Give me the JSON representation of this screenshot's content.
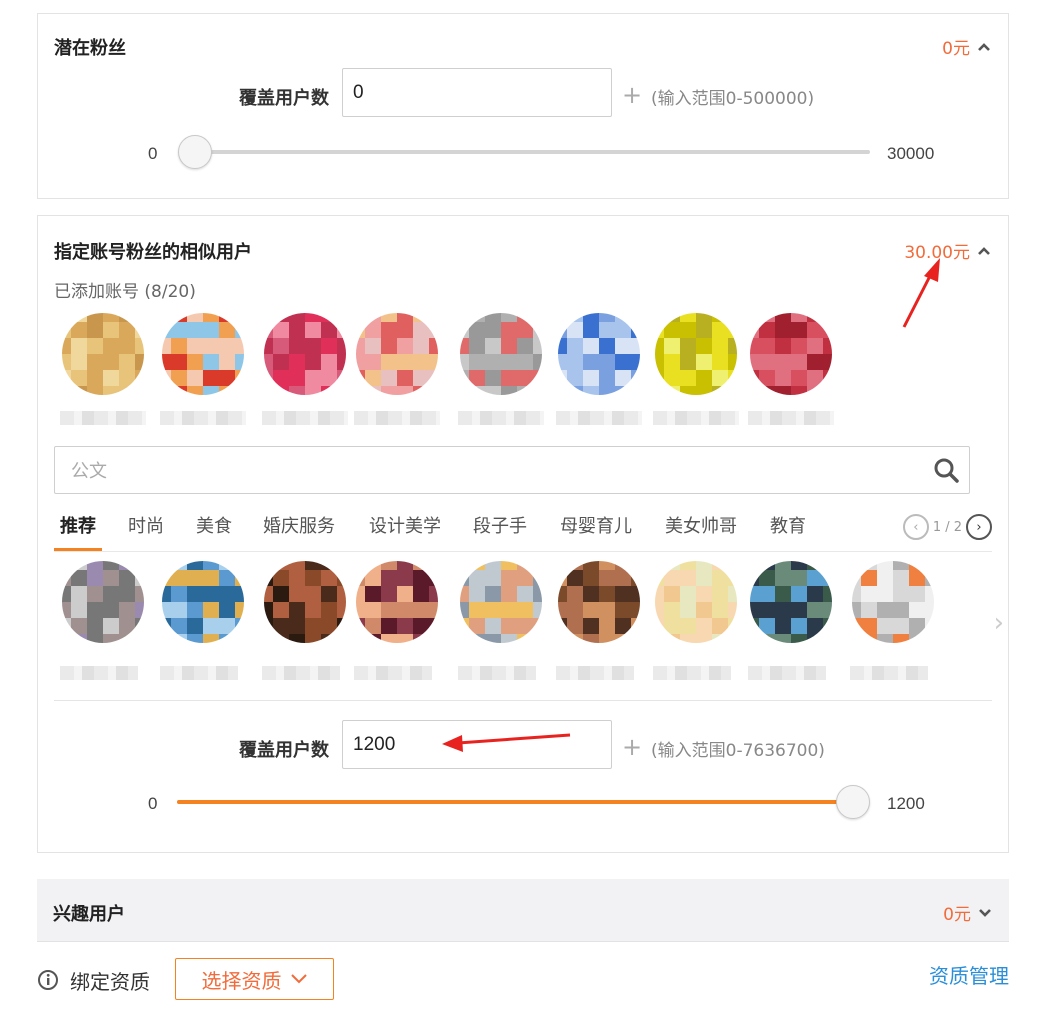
{
  "potential_fans": {
    "title": "潜在粉丝",
    "price": "0元",
    "cover_label": "覆盖用户数",
    "cover_value": "0",
    "plus": "+",
    "range_hint": "(输入范围0-500000)",
    "slider_min": "0",
    "slider_max": "30000",
    "slider_fraction": 0
  },
  "similar_users": {
    "title": "指定账号粉丝的相似用户",
    "price": "30.00元",
    "added_count": "已添加账号 (8/20)",
    "search_placeholder": "公文",
    "tabs": [
      {
        "label": "推荐",
        "active": true
      },
      {
        "label": "时尚"
      },
      {
        "label": "美食"
      },
      {
        "label": "婚庆服务"
      },
      {
        "label": "设计美学"
      },
      {
        "label": "段子手"
      },
      {
        "label": "母婴育儿"
      },
      {
        "label": "美女帅哥"
      },
      {
        "label": "教育"
      }
    ],
    "pager": "1 / 2",
    "cover_label": "覆盖用户数",
    "cover_value": "1200",
    "plus": "+",
    "range_hint": "(输入范围0-7636700)",
    "slider_min": "0",
    "slider_max": "1200",
    "slider_fraction": 1
  },
  "interest_users": {
    "title": "兴趣用户",
    "price": "0元"
  },
  "qualification": {
    "label": "绑定资质",
    "select_button": "选择资质",
    "manage_link": "资质管理"
  },
  "colors": {
    "accent": "#f58220",
    "price": "#f26b3a",
    "link": "#2a8fd8",
    "annotation_arrow": "#e8231f"
  }
}
